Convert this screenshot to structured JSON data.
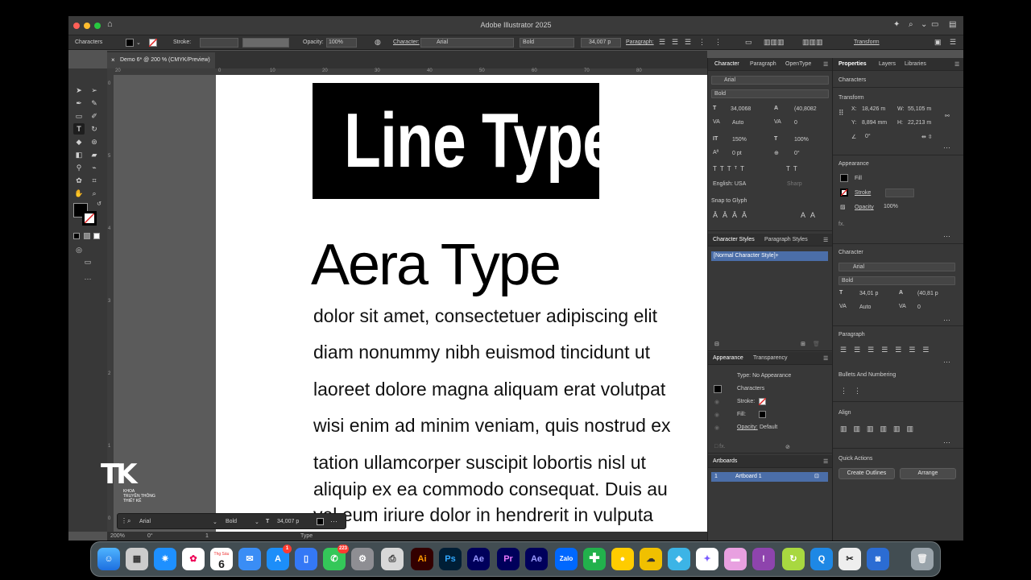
{
  "app": {
    "title": "Adobe Illustrator 2025",
    "doc_tab": "Demo 6* @ 200 % (CMYK/Preview)",
    "control_bar": {
      "mode_label": "Characters",
      "stroke_label": "Stroke:",
      "opacity_label": "Opacity:",
      "opacity_value": "100%",
      "character_label": "Character:",
      "font_name": "Arial",
      "font_style": "Bold",
      "font_size": "34,007 p",
      "paragraph_label": "Paragraph:",
      "transform_label": "Transform"
    },
    "ruler_top": [
      "20",
      "0",
      "10",
      "20",
      "30",
      "40",
      "50",
      "60",
      "70",
      "80"
    ],
    "ruler_left": [
      "0",
      "5",
      "4",
      "3",
      "2",
      "1",
      "0"
    ],
    "canvas": {
      "line_type_text": "Line Type",
      "area_title": "Aera Type",
      "area_lines": [
        "dolor sit amet, consectetuer adipiscing elit",
        "diam nonummy nibh euismod tincidunt ut",
        "laoreet dolore magna aliquam erat volutpat",
        "wisi enim ad minim veniam, quis nostrud ex",
        "tation ullamcorper suscipit lobortis nisl ut",
        "aliquip ex ea commodo consequat. Duis au",
        "vel eum iriure dolor in hendrerit in vulputa"
      ]
    },
    "context_bar": {
      "font": "Arial",
      "style": "Bold",
      "size": "34,007 p"
    },
    "status_bar": {
      "zoom": "200%",
      "angle": "0°",
      "artboard": "1",
      "tool": "Type"
    },
    "logo": {
      "mark": "TK",
      "line1": "KHOA",
      "line2": "TRUYỀN THÔNG",
      "line3": "THIẾT KẾ"
    }
  },
  "character_panel": {
    "tabs": [
      "Character",
      "Paragraph",
      "OpenType"
    ],
    "font": "Arial",
    "style": "Bold",
    "size": "34,0068",
    "leading": "(40,8082",
    "kerning": "Auto",
    "tracking": "0",
    "vscale": "150%",
    "hscale": "100%",
    "baseline": "0 pt",
    "rotation": "0°",
    "language": "English: USA",
    "aa": "Sharp",
    "snap_label": "Snap to Glyph"
  },
  "styles_panel": {
    "tabs": [
      "Character Styles",
      "Paragraph Styles"
    ],
    "items": [
      "[Normal Character Style]+"
    ]
  },
  "appearance_panel": {
    "tabs": [
      "Appearance",
      "Transparency"
    ],
    "type_label": "Type: No Appearance",
    "characters": "Characters",
    "stroke": "Stroke:",
    "fill": "Fill:",
    "opacity": "Opacity:",
    "opacity_value": "Default"
  },
  "artboards_panel": {
    "title": "Artboards",
    "items": [
      {
        "num": "1",
        "name": "Artboard 1"
      }
    ]
  },
  "properties_panel": {
    "tabs": [
      "Properties",
      "Layers",
      "Libraries"
    ],
    "section": "Characters",
    "transform_label": "Transform",
    "x": "18,426 m",
    "y": "8,894 mm",
    "w": "55,105 m",
    "h": "22,213 m",
    "angle": "0°",
    "appearance_label": "Appearance",
    "fill": "Fill",
    "stroke": "Stroke",
    "opacity_label": "Opacity",
    "opacity": "100%",
    "character_label": "Character",
    "font": "Arial",
    "style": "Bold",
    "size": "34,01 p",
    "leading": "(40,81 p",
    "kerning": "Auto",
    "tracking": "0",
    "paragraph_label": "Paragraph",
    "bullets_label": "Bullets And Numbering",
    "align_label": "Align",
    "quick_actions_label": "Quick Actions",
    "create_outlines": "Create Outlines",
    "arrange": "Arrange"
  },
  "dock": {
    "calendar_month": "Thg Sáu",
    "calendar_day": "6",
    "mail_badge": "223",
    "appstore_badge": "1",
    "app_labels": {
      "ai": "Ai",
      "ps": "Ps",
      "ae": "Ae",
      "pr": "Pr",
      "zalo": "Zalo"
    }
  },
  "colors": {
    "app_bg": "#535353",
    "panel_bg": "#383838",
    "selection": "#4b6ea8",
    "ai_orange": "#ff9a00",
    "ps_blue": "#31a8ff",
    "ae_purple": "#9999ff",
    "pr_purple": "#ea77ff"
  }
}
